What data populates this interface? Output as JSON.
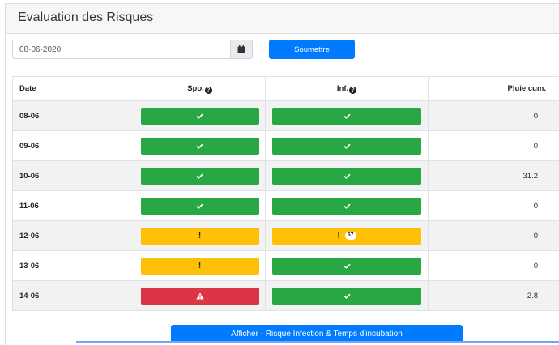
{
  "header": {
    "title": "Evaluation des Risques"
  },
  "form": {
    "date_value": "08-06-2020",
    "submit_label": "Soumettre"
  },
  "table": {
    "headers": {
      "date": "Date",
      "spo": "Spo.",
      "inf": "Inf.",
      "pluie": "Pluie cum."
    },
    "rows": [
      {
        "date": "08-06",
        "spo": "ok",
        "inf": "ok",
        "pluie": "0"
      },
      {
        "date": "09-06",
        "spo": "ok",
        "inf": "ok",
        "pluie": "0"
      },
      {
        "date": "10-06",
        "spo": "ok",
        "inf": "ok",
        "pluie": "31.2"
      },
      {
        "date": "11-06",
        "spo": "ok",
        "inf": "ok",
        "pluie": "0"
      },
      {
        "date": "12-06",
        "spo": "warning",
        "inf": "warning",
        "inf_badge": "67",
        "pluie": "0"
      },
      {
        "date": "13-06",
        "spo": "warning",
        "inf": "ok",
        "pluie": "0"
      },
      {
        "date": "14-06",
        "spo": "danger",
        "inf": "ok",
        "pluie": "2.8"
      }
    ]
  },
  "status_glyphs": {
    "warning": "!"
  },
  "icons": [
    "calendar-icon",
    "question-circle-icon",
    "check-icon",
    "exclamation-icon",
    "warning-triangle-icon"
  ],
  "colors": {
    "ok": "#28a745",
    "warning": "#ffc107",
    "danger": "#dc3545",
    "primary": "#007bff"
  },
  "bottom_button": {
    "label": "Afficher - Risque Infection & Temps d'incubation"
  }
}
